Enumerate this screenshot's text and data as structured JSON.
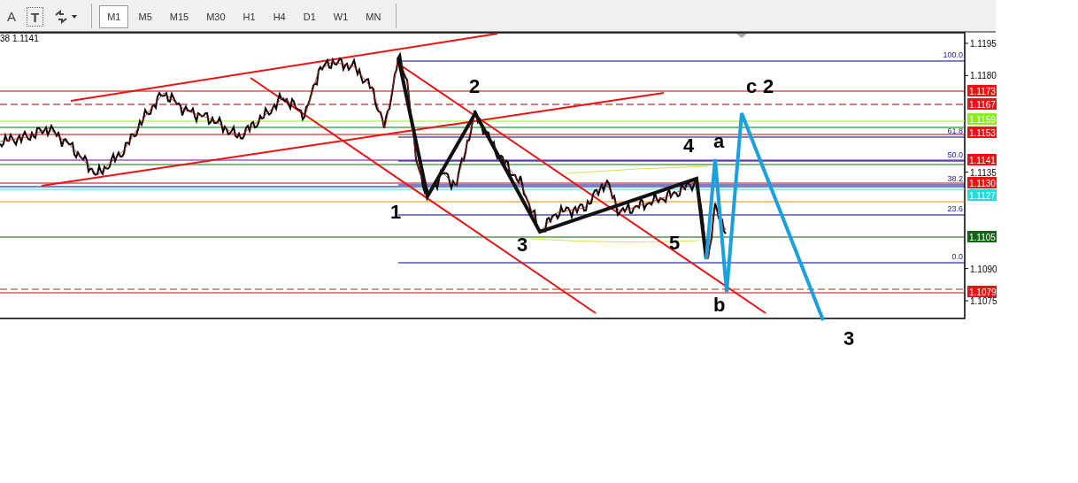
{
  "toolbar": {
    "tools": [
      {
        "kind": "text",
        "label": "A"
      },
      {
        "kind": "boxed",
        "label": "T"
      },
      {
        "kind": "arrows"
      }
    ],
    "timeframes": [
      {
        "label": "M1",
        "selected": true
      },
      {
        "label": "M5",
        "selected": false
      },
      {
        "label": "M15",
        "selected": false
      },
      {
        "label": "M30",
        "selected": false
      },
      {
        "label": "H1",
        "selected": false
      },
      {
        "label": "H4",
        "selected": false
      },
      {
        "label": "D1",
        "selected": false
      },
      {
        "label": "W1",
        "selected": false
      },
      {
        "label": "MN",
        "selected": false
      }
    ]
  },
  "chart": {
    "header": "38 1.1141",
    "price_axis": [
      "1.1195",
      "1.1180",
      "1.1135",
      "1.1090",
      "1.1075"
    ],
    "price_tags": [
      {
        "text": "1.1173",
        "color": "#ee1111"
      },
      {
        "text": "1.1167",
        "color": "#ee1111"
      },
      {
        "text": "1.1159",
        "color": "#88ee22"
      },
      {
        "text": "1.1153",
        "color": "#ee1111"
      },
      {
        "text": "1.1141",
        "color": "#ee1111"
      },
      {
        "text": "1.1130",
        "color": "#ee1111"
      },
      {
        "text": "1.1127",
        "color": "#22dddd"
      },
      {
        "text": "1.1105",
        "color": "#116611"
      },
      {
        "text": "1.1079",
        "color": "#ee1111"
      }
    ],
    "fib_levels": [
      "100.0",
      "61.8",
      "50.0",
      "38.2",
      "23.6",
      "0.0"
    ],
    "wave_labels": [
      "1",
      "2",
      "3",
      "4",
      "5",
      "a",
      "b",
      "c",
      "2",
      "3"
    ]
  }
}
